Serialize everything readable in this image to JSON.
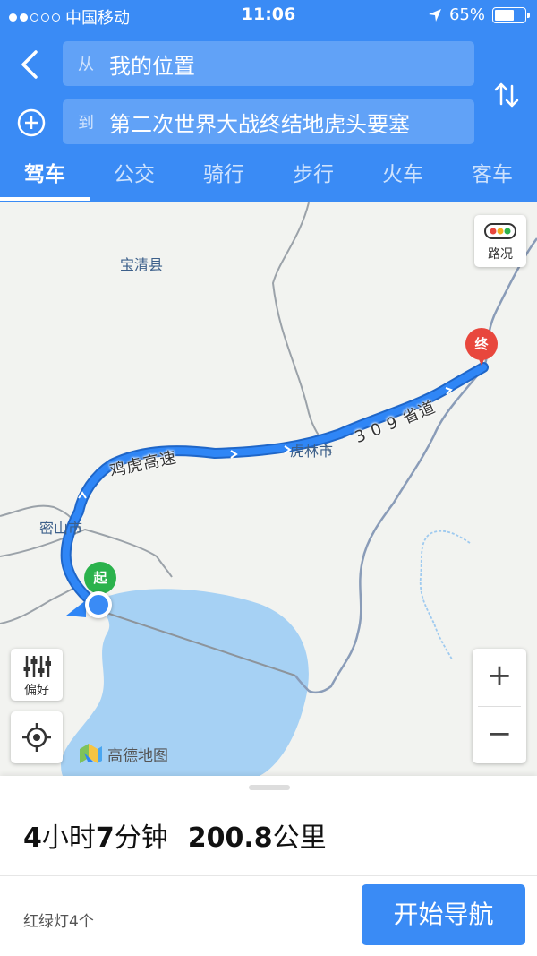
{
  "status_bar": {
    "carrier": "中国移动",
    "time": "11:06",
    "battery": "65%",
    "battery_level": 0.65
  },
  "route": {
    "from_prefix": "从",
    "from_value": "我的位置",
    "to_prefix": "到",
    "to_value": "第二次世界大战终结地虎头要塞"
  },
  "tabs": [
    {
      "label": "驾车",
      "active": true
    },
    {
      "label": "公交",
      "active": false
    },
    {
      "label": "骑行",
      "active": false
    },
    {
      "label": "步行",
      "active": false
    },
    {
      "label": "火车",
      "active": false
    },
    {
      "label": "客车",
      "active": false
    }
  ],
  "map": {
    "place_labels": {
      "baoqing": "宝清县",
      "mishan": "密山市",
      "hulin": "虎林市"
    },
    "road_labels": {
      "jihu": "鸡虎高速",
      "provincial": "3 0 9 省道"
    },
    "start_marker": "起",
    "end_marker": "终",
    "traffic_label": "路况",
    "preferences_label": "偏好",
    "zoom_in": "+",
    "zoom_out": "−",
    "logo_text": "高德地图",
    "colors": {
      "route": "#2f86f6",
      "start": "#2bb24c",
      "end": "#e8473d",
      "water": "#a6d1f4"
    }
  },
  "summary": {
    "hours": "4",
    "hours_unit": "小时",
    "minutes": "7",
    "minutes_unit": "分钟",
    "distance": "200.8",
    "distance_unit": "公里"
  },
  "traffic_lights": "红绿灯4个",
  "start_button": "开始导航"
}
